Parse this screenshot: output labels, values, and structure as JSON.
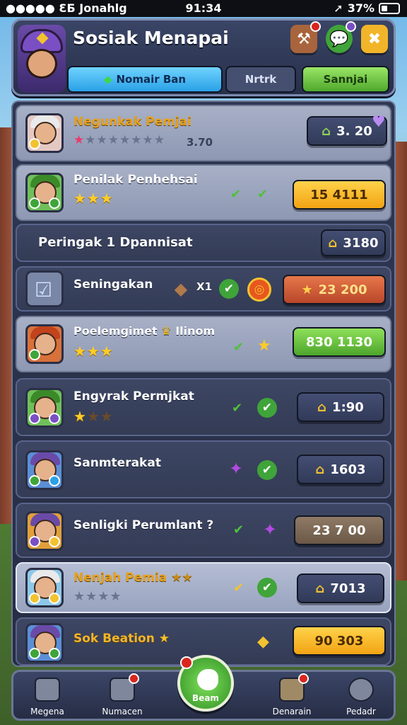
{
  "status": {
    "carrier": "●●●●● ƐƂ Jonahlg",
    "time": "91:34",
    "battery": "37%",
    "battery_level": 0.37
  },
  "header": {
    "title": "Sosiak Menapai",
    "tabs": [
      {
        "label": "Nomair Ban",
        "active": true
      },
      {
        "label": "Nrtrk",
        "active": false
      },
      {
        "label": "Sannjai",
        "active": false
      }
    ]
  },
  "rows": [
    {
      "name": "Negunkak Pemjai",
      "stars_on": 0,
      "rating": "3.70",
      "value": "3. 20"
    },
    {
      "name": "Penilak Penhehsai",
      "stars_on": 3,
      "value": "15 4111"
    },
    {
      "name": "Peringak 1 Dpannisat",
      "value": "3180"
    },
    {
      "name": "Seningakan",
      "badge": "X1",
      "value": "23 200"
    },
    {
      "name": "Poelemgimet",
      "name_tail": "Ilinom",
      "stars_on": 3,
      "value": "830 1130"
    },
    {
      "name": "Engyrak Permjkat",
      "stars_on": 1,
      "value": "1:90"
    },
    {
      "name": "Sanmterakat",
      "value": "1603"
    },
    {
      "name": "Senligki Perumlant ?",
      "value": "23 7 00"
    },
    {
      "name": "Nenjah Pemia",
      "stars_on": 0,
      "value": "7013"
    },
    {
      "name": "Sok Beation",
      "value": "90 303"
    }
  ],
  "nav": [
    {
      "label": "Megena"
    },
    {
      "label": "Numacen"
    },
    {
      "label": "Beam"
    },
    {
      "label": "Denarain"
    },
    {
      "label": "Pedadr"
    }
  ],
  "colors": {
    "gold": "#f2a314",
    "green": "#4da52b",
    "navy": "#313a58",
    "orange": "#b8462a"
  }
}
